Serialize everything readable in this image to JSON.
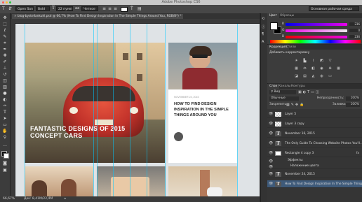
{
  "app": {
    "title": "Adobe Photoshop CS6"
  },
  "options_bar": {
    "font_family": "Open Sans",
    "font_style": "Bold",
    "font_size": "22 пункт.",
    "antialias": "Четкое",
    "workspace": "Основная рабочая среда"
  },
  "document": {
    "tab_label": "blog-bystellankuhl.psd @ 66,7% (How To Find Design  Inspiration In The Simple  Things Around You, RGB/8*) *"
  },
  "canvas": {
    "card_car": {
      "title_line1": "FANTASTIC DESIGNS OF 2015",
      "title_line2": "CONCEPT CARS"
    },
    "card_article": {
      "date": "NOVEMBER 24, 2015",
      "title_line1": "HOW TO FIND DESIGN",
      "title_line2": "INSPIRATION IN THE SIMPLE",
      "title_line3": "THINGS AROUND YOU"
    }
  },
  "status": {
    "zoom": "66,67%",
    "doc_size": "Док: 8,41М/22,4М"
  },
  "color_panel": {
    "tabs": [
      "Цвет",
      "Образцы"
    ],
    "r_value": "236",
    "g_value": "0",
    "b_value": "236"
  },
  "adjustments_panel": {
    "tabs": [
      "Коррекция",
      "Стили"
    ],
    "add_label": "Добавить корректировку"
  },
  "layers_panel": {
    "tabs": [
      "Слои",
      "Каналы",
      "Контуры"
    ],
    "kind_filter": "Вид",
    "blend_mode": "Обычные",
    "opacity_label": "Непрозрачность:",
    "opacity_value": "100%",
    "lock_label": "Закрепить:",
    "fill_label": "Заливка:",
    "fill_value": "100%",
    "layers": [
      {
        "name": "Layer 5",
        "kind": "pixel"
      },
      {
        "name": "Layer 3 copy",
        "kind": "pixel"
      },
      {
        "name": "November 16, 2015",
        "kind": "text"
      },
      {
        "name": "The Only Guide To Choosing Website Photos You'll...",
        "kind": "text"
      },
      {
        "name": "Rectangle 4 copy 3",
        "kind": "shape"
      },
      {
        "name": "Эффекты",
        "kind": "effects"
      },
      {
        "name": "Наложение цвета",
        "kind": "effect"
      },
      {
        "name": "November 24, 2015",
        "kind": "text"
      },
      {
        "name": "How To Find Design  Inspiration In The Simple  Things...",
        "kind": "text"
      }
    ]
  }
}
